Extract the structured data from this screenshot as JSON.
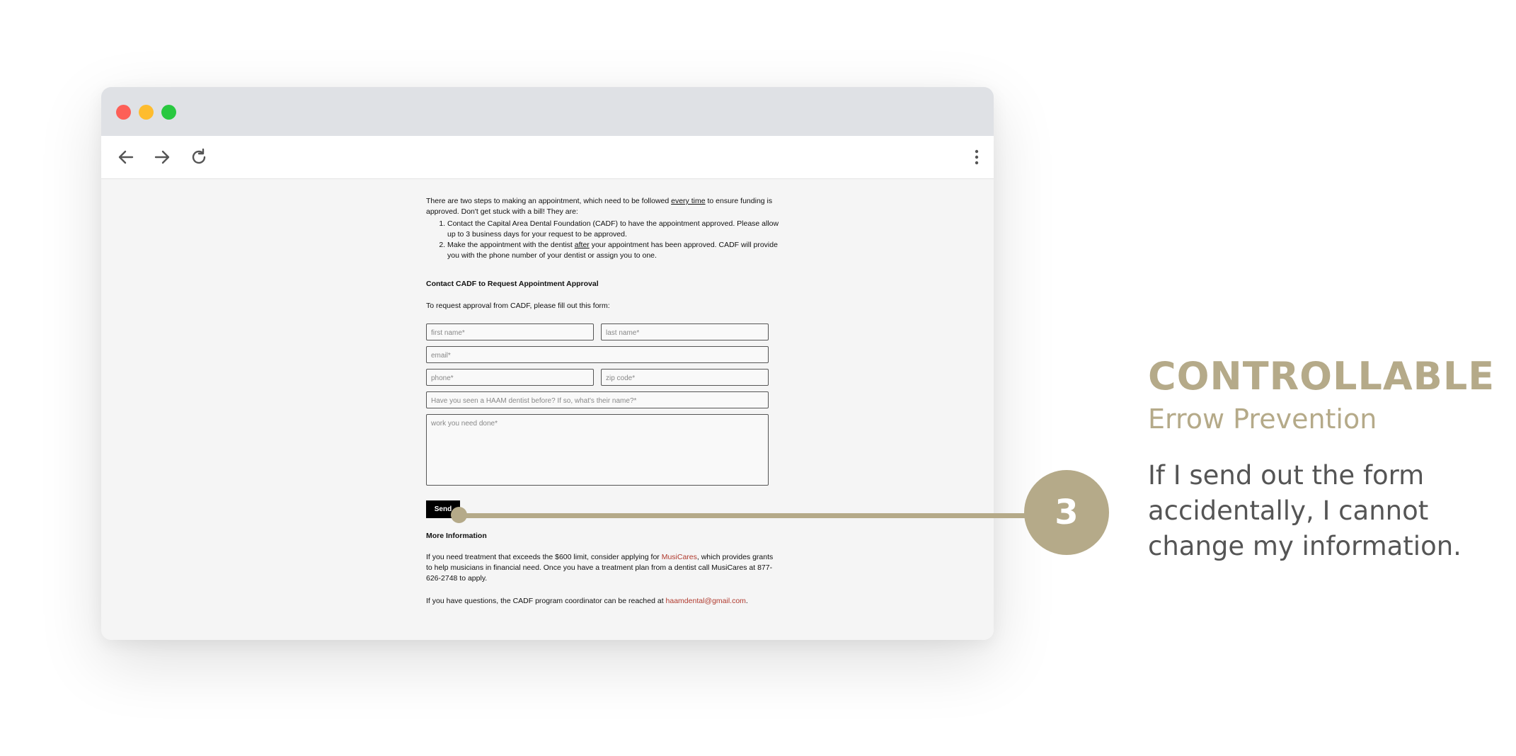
{
  "browser": {
    "toolbar": {
      "back_icon": "arrow-left-icon",
      "forward_icon": "arrow-right-icon",
      "reload_icon": "reload-icon",
      "menu_icon": "kebab-menu-icon"
    }
  },
  "page": {
    "intro_a": "There are two steps to making an appointment, which need to be followed ",
    "intro_u": "every time",
    "intro_b": " to ensure funding is approved. Don't get stuck with a bill! They are:",
    "step1": "Contact the Capital Area Dental Foundation (CADF) to have the appointment approved. Please allow up to 3 business days for your request to be approved.",
    "step2_a": "Make the appointment with the dentist ",
    "step2_u": "after",
    "step2_b": " your appointment has been approved. CADF will provide you with the phone number of your dentist or assign you to one.",
    "contact_heading": "Contact CADF to Request Appointment Approval",
    "form_intro": "To request approval from CADF, please fill out this form:",
    "form": {
      "first_name": "first name*",
      "last_name": "last name*",
      "email": "email*",
      "phone": "phone*",
      "zip": "zip code*",
      "haam_dentist": "Have you seen a HAAM dentist before? If so, what's their name?*",
      "work": "work you need done*",
      "send": "Send"
    },
    "more_heading": "More Information",
    "more_a": "If you need treatment that exceeds the $600 limit, consider applying for ",
    "more_link": "MusiCares",
    "more_b": ", which provides grants to help musicians in financial need. Once you have a treatment plan from a dentist call MusiCares at 877-626-2748 to apply.",
    "questions_a": "If you have questions, the CADF program coordinator can be reached at ",
    "questions_link": "haamdental@gmail.com",
    "questions_b": "."
  },
  "annotation": {
    "number": "3",
    "title": "CONTROLLABLE",
    "subtitle": "Errow Prevention",
    "description": "If I send out the form accidentally, I cannot change my information.",
    "accent_color": "#b5aa89"
  }
}
